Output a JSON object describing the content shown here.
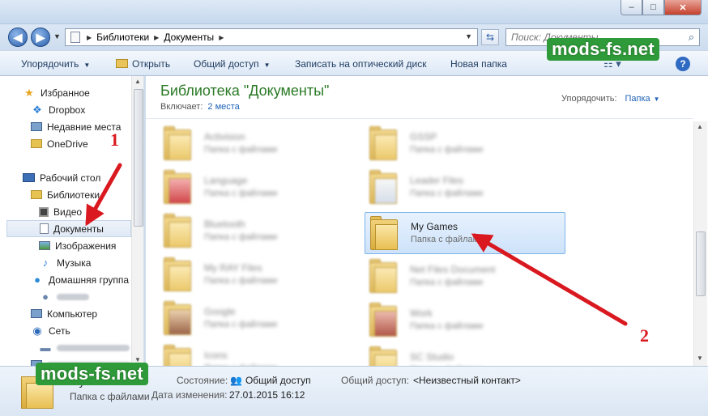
{
  "window": {
    "buttons": {
      "minimize": "‒",
      "maximize": "□",
      "close": "✕"
    }
  },
  "address": {
    "crumbs": [
      "Библиотеки",
      "Документы"
    ],
    "search_placeholder": "Поиск: Документы"
  },
  "toolbar": {
    "organize": "Упорядочить",
    "open": "Открыть",
    "share": "Общий доступ",
    "burn": "Записать на оптический диск",
    "new_folder": "Новая папка"
  },
  "sidebar": {
    "items": [
      {
        "label": "Избранное",
        "icon": "star-icon"
      },
      {
        "label": "Dropbox",
        "icon": "dropbox-icon"
      },
      {
        "label": "Недавние места",
        "icon": "recent-places-icon"
      },
      {
        "label": "OneDrive",
        "icon": "folder-icon"
      },
      {
        "label": "Рабочий стол",
        "icon": "desktop-icon"
      },
      {
        "label": "Библиотеки",
        "icon": "libraries-icon"
      },
      {
        "label": "Видео",
        "icon": "video-icon"
      },
      {
        "label": "Документы",
        "icon": "document-icon"
      },
      {
        "label": "Изображения",
        "icon": "pictures-icon"
      },
      {
        "label": "Музыка",
        "icon": "music-icon"
      },
      {
        "label": "Домашняя группа",
        "icon": "homegroup-icon"
      },
      {
        "label": "Компьютер",
        "icon": "computer-icon"
      },
      {
        "label": "Сеть",
        "icon": "network-icon"
      }
    ]
  },
  "library": {
    "title": "Библиотека \"Документы\"",
    "includes_label": "Включает:",
    "includes_link": "2 места",
    "arrange_label": "Упорядочить:",
    "arrange_value": "Папка"
  },
  "files": {
    "selected": {
      "name": "My Games",
      "type": "Папка с файлами"
    }
  },
  "details": {
    "type": "Папка с файлами",
    "state_label": "Состояние:",
    "state_value": "Общий доступ",
    "shared_label": "Общий доступ:",
    "shared_value": "<Неизвестный контакт>",
    "modified_label": "Дата изменения:",
    "modified_value": "27.01.2015 16:12"
  },
  "watermark": "mods-fs.net",
  "annotations": {
    "n1": "1",
    "n2": "2"
  },
  "colors": {
    "accent_green": "#2a7a25",
    "link_blue": "#1f63b8",
    "arrow_red": "#d9191f",
    "selection": "#cde2fa"
  }
}
